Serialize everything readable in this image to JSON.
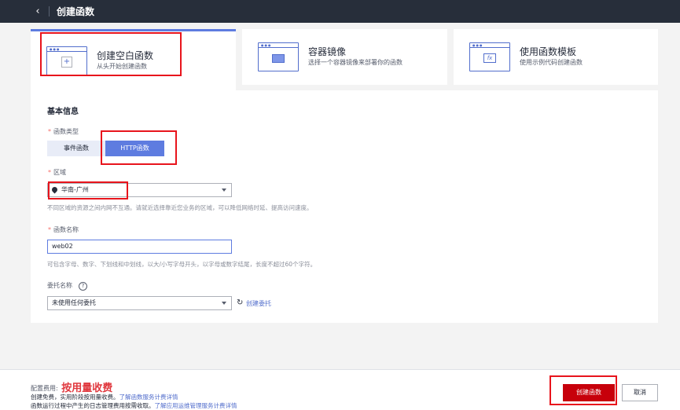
{
  "header": {
    "back_icon": "chevron-left-icon",
    "title": "创建函数"
  },
  "create_options": [
    {
      "name": "创建空白函数",
      "desc": "从头开始创建函数",
      "icon": "blank-window-icon",
      "selected": true
    },
    {
      "name": "容器镜像",
      "desc": "选择一个容器镜像来部署你的函数",
      "icon": "container-image-icon",
      "selected": false
    },
    {
      "name": "使用函数模板",
      "desc": "使用示例代码创建函数",
      "icon": "template-fx-icon",
      "selected": false
    }
  ],
  "form": {
    "section_title": "基本信息",
    "required_mark": "*",
    "func_type": {
      "label": "函数类型",
      "options": [
        "事件函数",
        "HTTP函数"
      ],
      "selected": "HTTP函数"
    },
    "region": {
      "label": "区域",
      "value": "华南-广州",
      "hint": "不同区域的资源之间内网不互通。请就近选择靠近您业务的区域，可以降低网络时延、提高访问速度。"
    },
    "func_name": {
      "label": "函数名称",
      "value": "web02",
      "hint": "可包含字母、数字、下划线和中划线，以大/小写字母开头，以字母或数字结尾，长度不超过60个字符。"
    },
    "agency": {
      "label": "委托名称",
      "help": "?",
      "value": "未使用任何委托",
      "refresh_icon": "↻",
      "create_link": "创建委托"
    }
  },
  "footer": {
    "fee_label": "配置费用:",
    "fee_value": "按用量收费",
    "line1_text": "创建免费，实用阶段按用量收费。",
    "line1_link": "了解函数服务计费详情",
    "line2_text": "函数运行过程中产生的日志管理费用按需收取。",
    "line2_link": "了解应用运维管理服务计费详情",
    "create_label": "创建函数",
    "cancel_label": "取消"
  }
}
